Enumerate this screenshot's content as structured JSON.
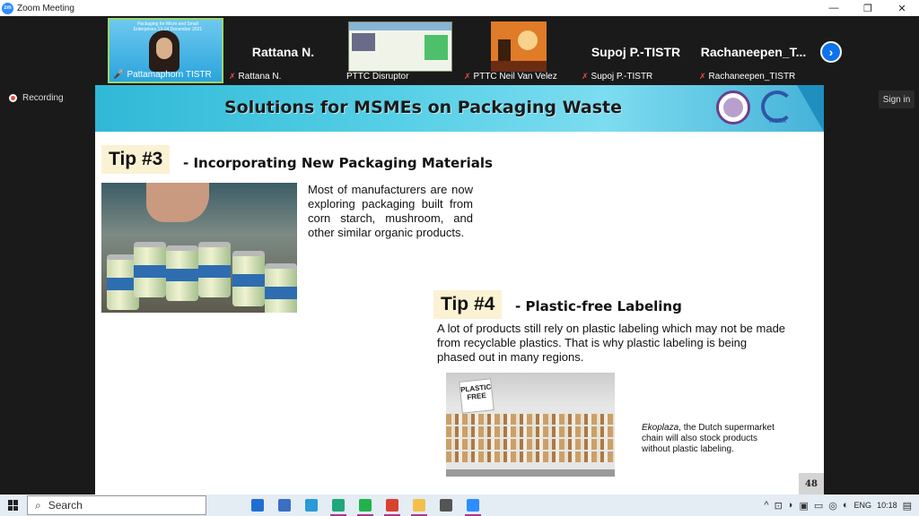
{
  "window": {
    "title": "Zoom Meeting",
    "app_icon_text": "zm",
    "minimize_glyph": "—",
    "maximize_glyph": "❐",
    "close_glyph": "✕"
  },
  "participants": [
    {
      "name": "Pattamaphorn TISTR",
      "big_name": "",
      "muted": false,
      "tile_text": "Packaging for Micro and Small Enterprises 13-14 December 2021"
    },
    {
      "name": "Rattana N.",
      "big_name": "Rattana N.",
      "muted": true
    },
    {
      "name": "PTTC Disruptor",
      "big_name": "",
      "muted": false
    },
    {
      "name": "PTTC Neil Van Velez",
      "big_name": "",
      "muted": true
    },
    {
      "name": "Supoj P.-TISTR",
      "big_name": "Supoj P.-TISTR",
      "muted": true
    },
    {
      "name": "Rachaneepen_TISTR",
      "big_name": "Rachaneepen_T...",
      "muted": true
    }
  ],
  "next_glyph": "›",
  "recording_label": "Recording",
  "signin_label": "Sign in",
  "slide": {
    "title": "Solutions for MSMEs on Packaging Waste",
    "logo_text": "TISTR",
    "tip3": {
      "label": "Tip #3",
      "subtitle": "- Incorporating New Packaging Materials",
      "text": "Most of manufacturers are now exploring packaging built from corn starch, mushroom, and other similar organic products."
    },
    "tip4": {
      "label": "Tip #4",
      "subtitle": "- Plastic-free Labeling",
      "text": "A lot of products still rely on plastic labeling which may not be made from recyclable plastics. That is why plastic labeling is being phased out in many regions."
    },
    "store_sign": "PLASTIC FREE",
    "caption_italic": "Ekoplaza",
    "caption_rest": ", the Dutch supermarket chain will also stock products without plastic labeling.",
    "page_number": "48"
  },
  "taskbar": {
    "search_label": "Search",
    "search_glyph": "⌕",
    "language": "ENG",
    "time": "10:18",
    "tray_glyphs": [
      "^",
      "⊡",
      "◗",
      "▣",
      "▭",
      "◎",
      "◐"
    ],
    "notification_glyph": "▤",
    "apps": [
      {
        "name": "mail",
        "color": "#1f6fd1",
        "running": false
      },
      {
        "name": "store",
        "color": "#3a6fc4",
        "running": false
      },
      {
        "name": "ie",
        "color": "#2a9ad8",
        "running": false
      },
      {
        "name": "edge",
        "color": "#1fa67a",
        "running": true
      },
      {
        "name": "line",
        "color": "#21b24b",
        "running": true
      },
      {
        "name": "chrome",
        "color": "#d8432f",
        "running": true
      },
      {
        "name": "explorer",
        "color": "#f2c04a",
        "running": true
      },
      {
        "name": "settings",
        "color": "#555555",
        "running": false
      },
      {
        "name": "zoom",
        "color": "#2d8cff",
        "running": true
      }
    ]
  }
}
